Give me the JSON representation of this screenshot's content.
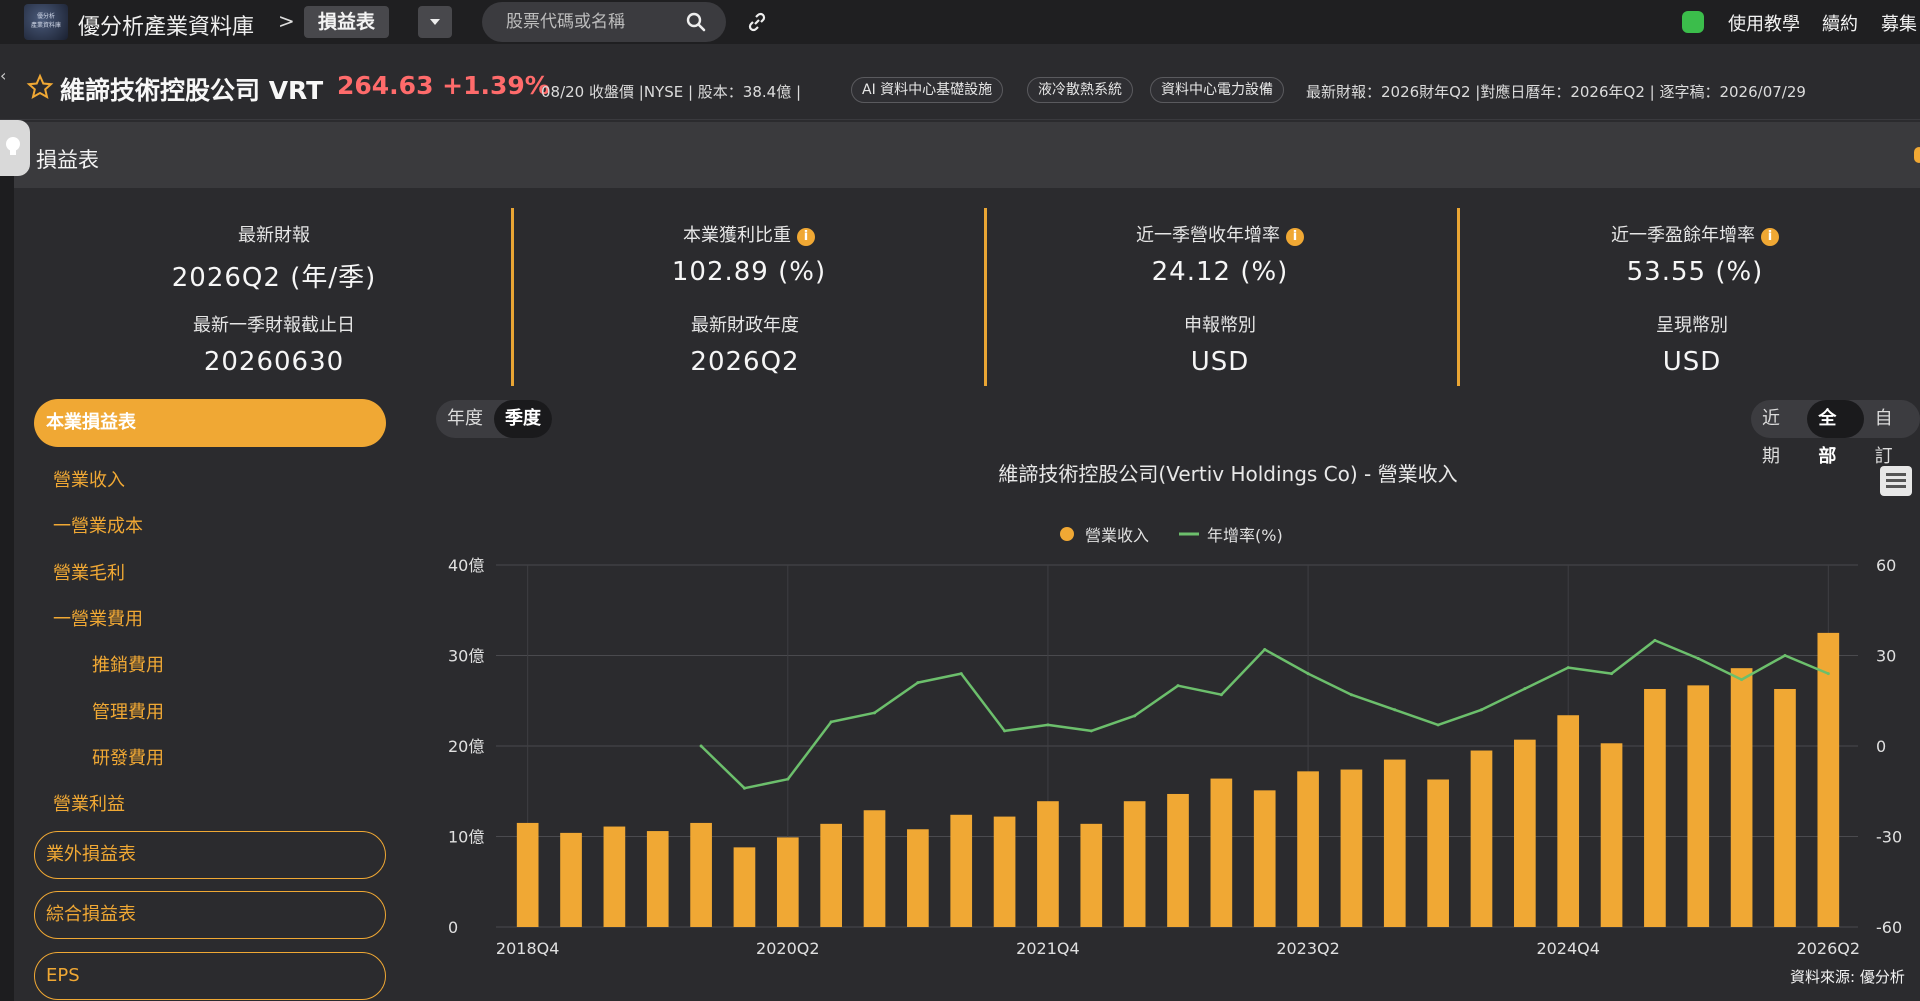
{
  "topnav": {
    "logo_text": "優分析\n產業資料庫",
    "breadcrumb": "優分析產業資料庫",
    "separator": ">",
    "current_tab": "損益表",
    "search_placeholder": "股票代碼或名稱",
    "links": [
      "使用教學",
      "續約",
      "募集"
    ]
  },
  "stock": {
    "name": "維諦技術控股公司 VRT",
    "price": "264.63 +1.39%",
    "meta": "08/20 收盤價 |NYSE | 股本：38.4億 |",
    "tags": [
      "AI 資料中心基礎設施",
      "液冷散熱系統",
      "資料中心電力設備"
    ],
    "meta2": "最新財報：2026財年Q2 |對應日曆年：2026年Q2 | 逐字稿：2026/07/29"
  },
  "section": {
    "title": "損益表"
  },
  "stats": [
    {
      "label": "最新財報",
      "value": "2026Q2 (年/季)",
      "info": false
    },
    {
      "label": "本業獲利比重",
      "value": "102.89 (%)",
      "info": true
    },
    {
      "label": "近一季營收年增率",
      "value": "24.12 (%)",
      "info": true
    },
    {
      "label": "近一季盈餘年增率",
      "value": "53.55 (%)",
      "info": true
    },
    {
      "label": "最新一季財報截止日",
      "value": "20260630",
      "info": false
    },
    {
      "label": "最新財政年度",
      "value": "2026Q2",
      "info": false
    },
    {
      "label": "申報幣別",
      "value": "USD",
      "info": false
    },
    {
      "label": "呈現幣別",
      "value": "USD",
      "info": false
    }
  ],
  "menu": {
    "main": "本業損益表",
    "items": [
      "營業收入",
      "一營業成本",
      "營業毛利",
      "一營業費用",
      "推銷費用",
      "管理費用",
      "研發費用",
      "營業利益"
    ],
    "outlined": [
      "業外損益表",
      "綜合損益表",
      "EPS"
    ]
  },
  "period_toggle": {
    "options": [
      "年度",
      "季度"
    ],
    "selected": "季度"
  },
  "range_toggle": {
    "options": [
      "近期",
      "全部",
      "自訂"
    ],
    "selected": "全部"
  },
  "source": "資料來源: 優分析",
  "colors": {
    "accent": "#f0a834",
    "line": "#6cbf6c",
    "price_up": "#ff6b6b"
  },
  "chart_data": {
    "type": "bar",
    "title": "維諦技術控股公司(Vertiv Holdings Co) - 營業收入",
    "categories": [
      "2018Q4",
      "2019Q1",
      "2019Q2",
      "2019Q3",
      "2019Q4",
      "2020Q1",
      "2020Q2",
      "2020Q3",
      "2020Q4",
      "2021Q1",
      "2021Q2",
      "2021Q3",
      "2021Q4",
      "2022Q1",
      "2022Q2",
      "2022Q3",
      "2022Q4",
      "2023Q1",
      "2023Q2",
      "2023Q3",
      "2023Q4",
      "2024Q1",
      "2024Q2",
      "2024Q3",
      "2024Q4",
      "2025Q1",
      "2025Q2",
      "2025Q3",
      "2025Q4",
      "2026Q1",
      "2026Q2"
    ],
    "x_tick_labels": [
      "2018Q4",
      "2020Q2",
      "2021Q4",
      "2023Q2",
      "2024Q4",
      "2026Q2"
    ],
    "series": [
      {
        "name": "營業收入",
        "axis": "left",
        "values": [
          11.5,
          10.4,
          11.1,
          10.6,
          11.5,
          8.8,
          9.9,
          11.4,
          12.9,
          10.8,
          12.4,
          12.2,
          13.9,
          11.4,
          13.9,
          14.7,
          16.4,
          15.1,
          17.2,
          17.4,
          18.5,
          16.3,
          19.5,
          20.7,
          23.4,
          20.3,
          26.3,
          26.7,
          28.6,
          26.3,
          32.5
        ]
      },
      {
        "name": "年增率(%)",
        "axis": "right",
        "values": [
          null,
          null,
          null,
          null,
          0,
          -14,
          -11,
          8,
          11,
          21,
          24,
          5,
          7,
          5,
          10,
          20,
          17,
          32,
          24,
          17,
          12,
          7,
          12,
          19,
          26,
          24,
          35,
          29,
          22,
          30,
          24
        ]
      }
    ],
    "ylim_left": [
      0,
      40
    ],
    "yticks_left": [
      "0",
      "10億",
      "20億",
      "30億",
      "40億"
    ],
    "ylim_right": [
      -60,
      60
    ],
    "yticks_right": [
      "-60",
      "-30",
      "0",
      "30",
      "60"
    ],
    "legend_position": "top-center",
    "grid": true
  }
}
